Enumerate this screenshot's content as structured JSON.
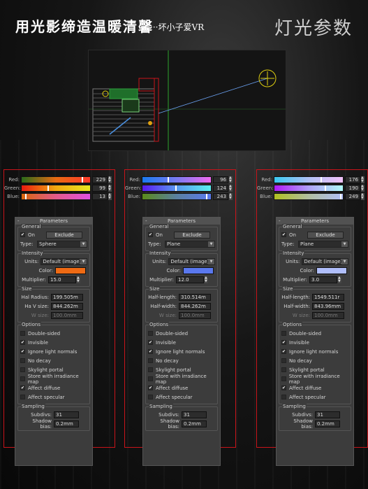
{
  "header": {
    "title": "用光影缔造温暖清馨",
    "subtitle": "···坏小子爱VR",
    "corner_title": "灯光参数"
  },
  "panels": [
    {
      "rgb": {
        "red": "229",
        "green": "99",
        "blue": "13",
        "red_pct": 0.9,
        "green_pct": 0.39,
        "blue_pct": 0.05,
        "red_grad": "linear-gradient(90deg,#2a6a1a,#e86a12,#ff3a2a)",
        "green_grad": "linear-gradient(90deg,#e81a10,#f2a810,#e8e820)",
        "blue_grad": "linear-gradient(90deg,#d8660c,#e05a8a,#e050e0)"
      },
      "params": {
        "header": "Parameters",
        "general": "General",
        "on": "On",
        "exclude": "Exclude",
        "type_label": "Type:",
        "type_value": "Sphere",
        "intensity": "Intensity",
        "units_label": "Units:",
        "units_value": "Default (image)",
        "color_label": "Color:",
        "color_hex": "#ee6a14",
        "multiplier_label": "Multiplier:",
        "multiplier": "15.0",
        "size": "Size",
        "size1_label": "Hal Radius:",
        "size1_value": "199.505m",
        "size2_label": "Ha V size:",
        "size2_value": "844.262m",
        "size3_label": "W size:",
        "size3_value": "100.0mm",
        "options": "Options",
        "opt": [
          "Double-sided",
          "Invisible",
          "Ignore light normals",
          "No decay",
          "Skylight portal",
          "Store with irradiance map",
          "Affect diffuse",
          "Affect specular"
        ],
        "opt_checked": [
          false,
          true,
          true,
          false,
          false,
          false,
          true,
          false
        ],
        "sampling": "Sampling",
        "subdivs_label": "Subdivs:",
        "subdivs": "31",
        "shadow_label": "Shadow bias:",
        "shadow": "0.2mm"
      }
    },
    {
      "rgb": {
        "red": "96",
        "green": "124",
        "blue": "243",
        "red_pct": 0.38,
        "green_pct": 0.49,
        "blue_pct": 0.95,
        "red_grad": "linear-gradient(90deg,#1a7af0,#7a7af0,#f06af0)",
        "green_grad": "linear-gradient(90deg,#5a1af0,#5a9af0,#5af0f0)",
        "blue_grad": "linear-gradient(90deg,#5a8a1a,#5a80a0,#5a7af0)"
      },
      "params": {
        "header": "Parameters",
        "general": "General",
        "on": "On",
        "exclude": "Exclude",
        "type_label": "Type:",
        "type_value": "Plane",
        "intensity": "Intensity",
        "units_label": "Units:",
        "units_value": "Default (image)",
        "color_label": "Color:",
        "color_hex": "#5a78ee",
        "multiplier_label": "Multiplier:",
        "multiplier": "12.0",
        "size": "Size",
        "size1_label": "Half-length:",
        "size1_value": "310.514m",
        "size2_label": "Half-width:",
        "size2_value": "844.262m",
        "size3_label": "W size:",
        "size3_value": "100.0mm",
        "options": "Options",
        "opt": [
          "Double-sided",
          "Invisible",
          "Ignore light normals",
          "No decay",
          "Skylight portal",
          "Store with irradiance map",
          "Affect diffuse",
          "Affect specular"
        ],
        "opt_checked": [
          false,
          true,
          true,
          false,
          false,
          false,
          true,
          false
        ],
        "sampling": "Sampling",
        "subdivs_label": "Subdivs:",
        "subdivs": "31",
        "shadow_label": "Shadow bias:",
        "shadow": "0.2mm"
      }
    },
    {
      "rgb": {
        "red": "176",
        "green": "190",
        "blue": "249",
        "red_pct": 0.69,
        "green_pct": 0.75,
        "blue_pct": 0.98,
        "red_grad": "linear-gradient(90deg,#3ac8f0,#b0c0f4,#f0c0f8)",
        "green_grad": "linear-gradient(90deg,#b01af8,#b0a0f8,#b0f8f8)",
        "blue_grad": "linear-gradient(90deg,#b0c020,#b0bea0,#b0bef8)"
      },
      "params": {
        "header": "Parameters",
        "general": "General",
        "on": "On",
        "exclude": "Exclude",
        "type_label": "Type:",
        "type_value": "Plane",
        "intensity": "Intensity",
        "units_label": "Units:",
        "units_value": "Default (image)",
        "color_label": "Color:",
        "color_hex": "#b0befa",
        "multiplier_label": "Multiplier:",
        "multiplier": "3.0",
        "size": "Size",
        "size1_label": "Half-length:",
        "size1_value": "1549.511r",
        "size2_label": "Half-width:",
        "size2_value": "843.96mm",
        "size3_label": "W size:",
        "size3_value": "100.0mm",
        "options": "Options",
        "opt": [
          "Double-sided",
          "Invisible",
          "Ignore light normals",
          "No decay",
          "Skylight portal",
          "Store with irradiance map",
          "Affect diffuse",
          "Affect specular"
        ],
        "opt_checked": [
          false,
          true,
          true,
          false,
          false,
          false,
          true,
          false
        ],
        "sampling": "Sampling",
        "subdivs_label": "Subdivs:",
        "subdivs": "31",
        "shadow_label": "Shadow bias:",
        "shadow": "0.2mm"
      }
    }
  ],
  "labels": {
    "red": "Red:",
    "green": "Green:",
    "blue": "Blue:",
    "minus": "-",
    "check": "✔"
  }
}
